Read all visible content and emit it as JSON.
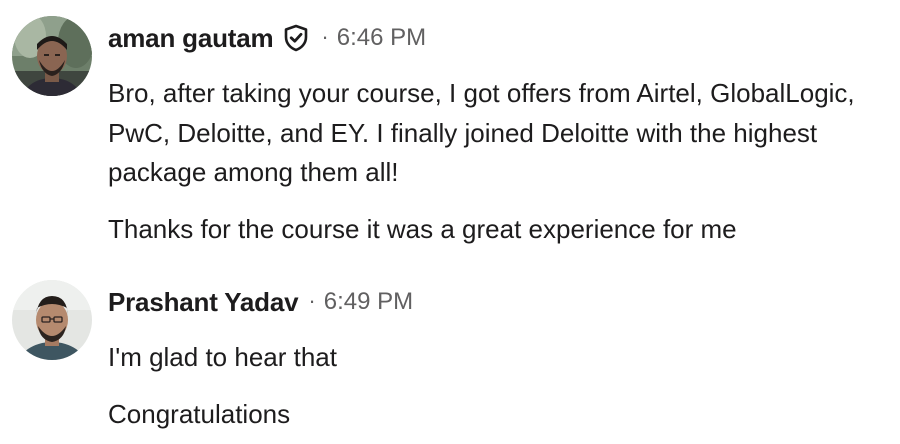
{
  "messages": [
    {
      "author": "aman gautam",
      "verified_icon": "shield-check-icon",
      "separator": "·",
      "time": "6:46 PM",
      "paragraphs": [
        "Bro, after taking your course, I got offers from Airtel, GlobalLogic, PwC, Deloitte, and EY. I finally joined Deloitte with the highest package among them all!",
        "Thanks for the course it was a great experience for me"
      ]
    },
    {
      "author": "Prashant Yadav",
      "separator": "·",
      "time": "6:49 PM",
      "paragraphs": [
        "I'm glad to hear that",
        "Congratulations"
      ]
    }
  ],
  "colors": {
    "text": "#1d1c1d",
    "meta": "#616061"
  }
}
